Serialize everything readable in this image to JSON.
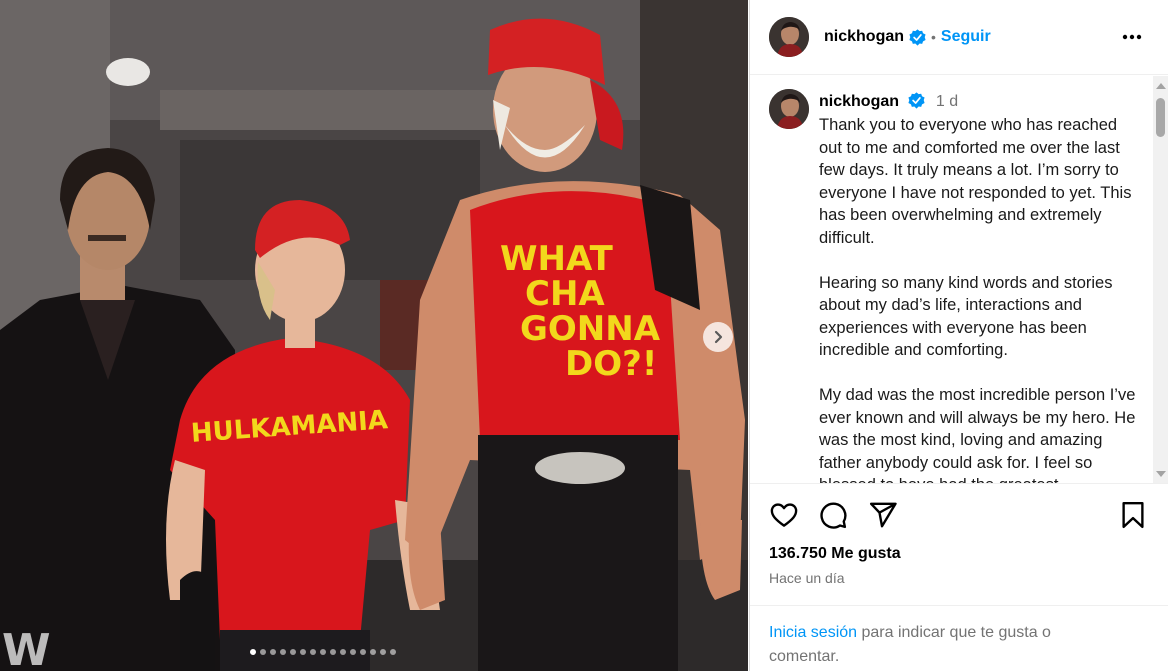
{
  "post": {
    "username": "nickhogan",
    "follow_label": "Seguir",
    "separator": "•",
    "time_ago_short": "1 d",
    "caption_paragraphs": [
      "Thank you to everyone who has reached out to me and comforted me over the last few days. It truly means a lot. I’m sorry to everyone I have not responded to yet. This has been overwhelming and extremely difficult.",
      "Hearing so many kind words and stories about my dad’s life, interactions and experiences with everyone has been incredible and comforting.",
      "My dad was the most incredible person I’ve ever known and will always be my hero. He was the most kind, loving and amazing father anybody could ask for. I feel so blessed to have had the greatest"
    ],
    "likes_label": "136.750 Me gusta",
    "time_ago_long": "Hace un día",
    "login_link": "Inicia sesión",
    "login_rest": " para indicar que te gusta o comentar."
  },
  "media": {
    "carousel_dots": 15,
    "active_dot": 0,
    "shirt_texts": {
      "left": "HULKAMANIA",
      "right_lines": [
        "WHAT",
        "CHA",
        "GONNA",
        "DO?!"
      ]
    }
  },
  "icons": {
    "verified": "verified-badge-icon",
    "more": "more-options-icon",
    "like": "heart-icon",
    "comment": "comment-icon",
    "share": "share-icon",
    "save": "bookmark-icon",
    "next": "chevron-right-icon"
  },
  "colors": {
    "link_blue": "#0095f6",
    "verified_blue": "#0095f6",
    "muted": "#737373",
    "shirt_red": "#d8161c",
    "shirt_yellow": "#f2d81c"
  }
}
